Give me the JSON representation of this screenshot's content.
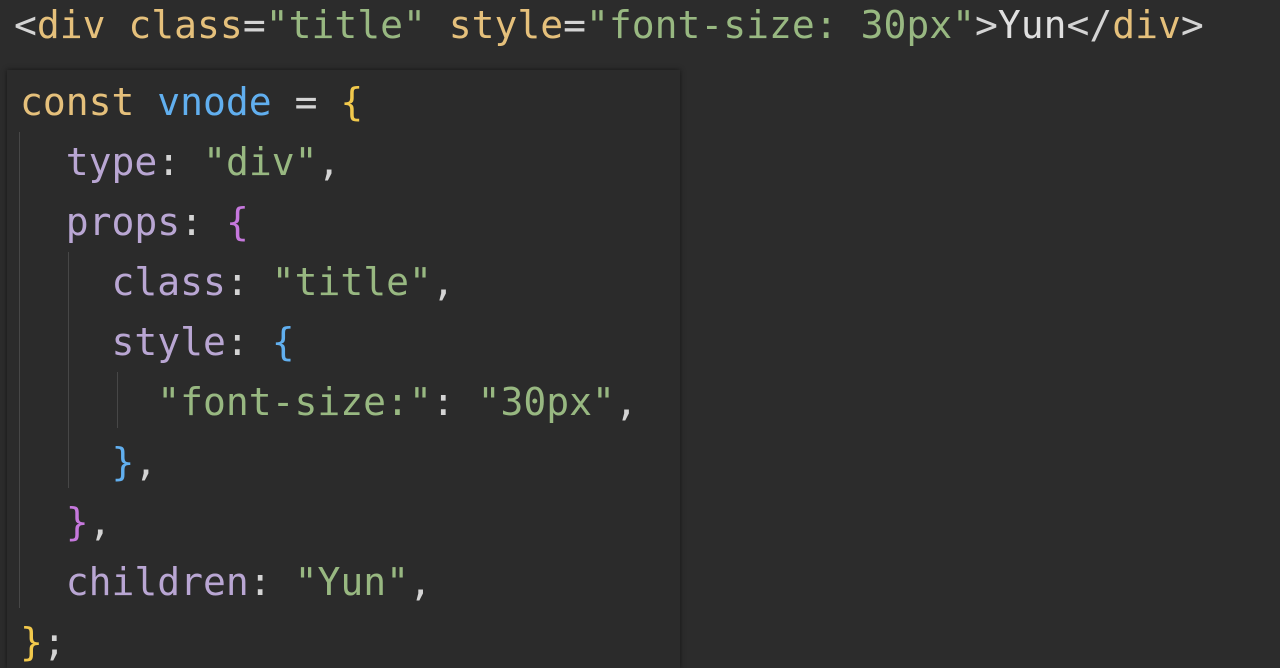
{
  "html_source": {
    "lt": "<",
    "tag": "div",
    "attr_class": "class",
    "eq": "=",
    "class_value": "\"title\"",
    "attr_style": "style",
    "style_value": "\"font-size: 30px\"",
    "gt": ">",
    "text": "Yun",
    "close_open": "</",
    "close_gt": ">"
  },
  "vnode_code": {
    "keyword": "const",
    "var_name": "vnode",
    "assign": "=",
    "open_brace": "{",
    "close_brace": "}",
    "semicolon": ";",
    "type_key": "type",
    "type_value": "\"div\"",
    "props_key": "props",
    "class_key": "class",
    "class_value": "\"title\"",
    "style_key": "style",
    "font_size_key": "\"font-size:\"",
    "font_size_value": "\"30px\"",
    "children_key": "children",
    "children_value": "\"Yun\"",
    "colon": ":",
    "comma": ","
  },
  "colors": {
    "background": "#2c2c2c",
    "keyword": "#e5c07b",
    "variable": "#61afef",
    "property": "#b9a6d3",
    "string": "#98b881",
    "bracket_level_1": "#f2c94c",
    "bracket_level_2": "#c678dd",
    "bracket_level_3": "#61afef"
  }
}
